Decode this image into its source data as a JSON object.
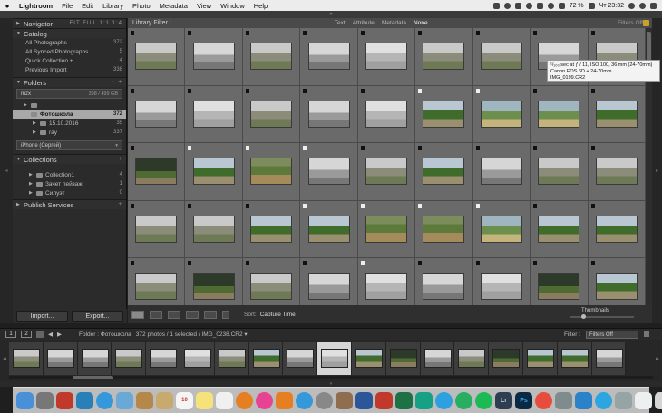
{
  "menubar": {
    "app": "Lightroom",
    "items": [
      "File",
      "Edit",
      "Library",
      "Photo",
      "Metadata",
      "View",
      "Window",
      "Help"
    ],
    "status": {
      "battery": "72 %",
      "clock": "Чт 23:32"
    }
  },
  "left": {
    "navigator": {
      "title": "Navigator",
      "zoom": "FIT  FILL  1:1  1:4"
    },
    "catalog": {
      "title": "Catalog",
      "items": [
        {
          "label": "All Photographs",
          "count": "372"
        },
        {
          "label": "All Synced Photographs",
          "count": "5"
        },
        {
          "label": "Quick Collection +",
          "count": "4"
        },
        {
          "label": "Previous Import",
          "count": "338"
        }
      ]
    },
    "folders": {
      "title": "Folders",
      "actions": "− +",
      "drive": {
        "name": "mzx",
        "info": "398 / 499 GB"
      },
      "items": [
        {
          "label": "Фотошкола",
          "count": "372"
        },
        {
          "label": "15.10.2016",
          "count": "35"
        },
        {
          "label": "ray",
          "count": "337"
        }
      ],
      "device": "iPhone (Сергей)"
    },
    "collections": {
      "title": "Collections",
      "actions": "+",
      "items": [
        {
          "label": "Collection1",
          "count": "4"
        },
        {
          "label": "Зачет пейзаж",
          "count": "1"
        },
        {
          "label": "Силуэт",
          "count": "0"
        }
      ]
    },
    "publish": {
      "title": "Publish Services",
      "actions": "+"
    },
    "buttons": {
      "import": "Import...",
      "export": "Export..."
    }
  },
  "filterbar": {
    "title": "Library Filter :",
    "options": [
      "Text",
      "Attribute",
      "Metadata",
      "None"
    ],
    "active": "None",
    "filters_off": "Filters Off"
  },
  "tooltip": {
    "line1": "¹/₁₀₀ sec at ƒ / 11, ISO 100, 36 mm (24-70mm)",
    "line2": "Canon EOS 6D + 24-70mm",
    "line3": "IMG_0199.CR2"
  },
  "toolbar": {
    "sort_label": "Sort:",
    "sort_value": "Capture Time",
    "thumbnails": "Thumbnails"
  },
  "secondary": {
    "page1": "1",
    "page2": "2",
    "path": "Folder : Фотошкола",
    "info": "372 photos / 1 selected / IMG_0238.CR2 ▾",
    "filter_label": "Filter :",
    "filter_value": "Filters Off"
  },
  "dock_labels": [
    "Lr",
    "Ps"
  ],
  "colors": {
    "accent": "#c9a227",
    "selection": "#a8a8a8"
  }
}
